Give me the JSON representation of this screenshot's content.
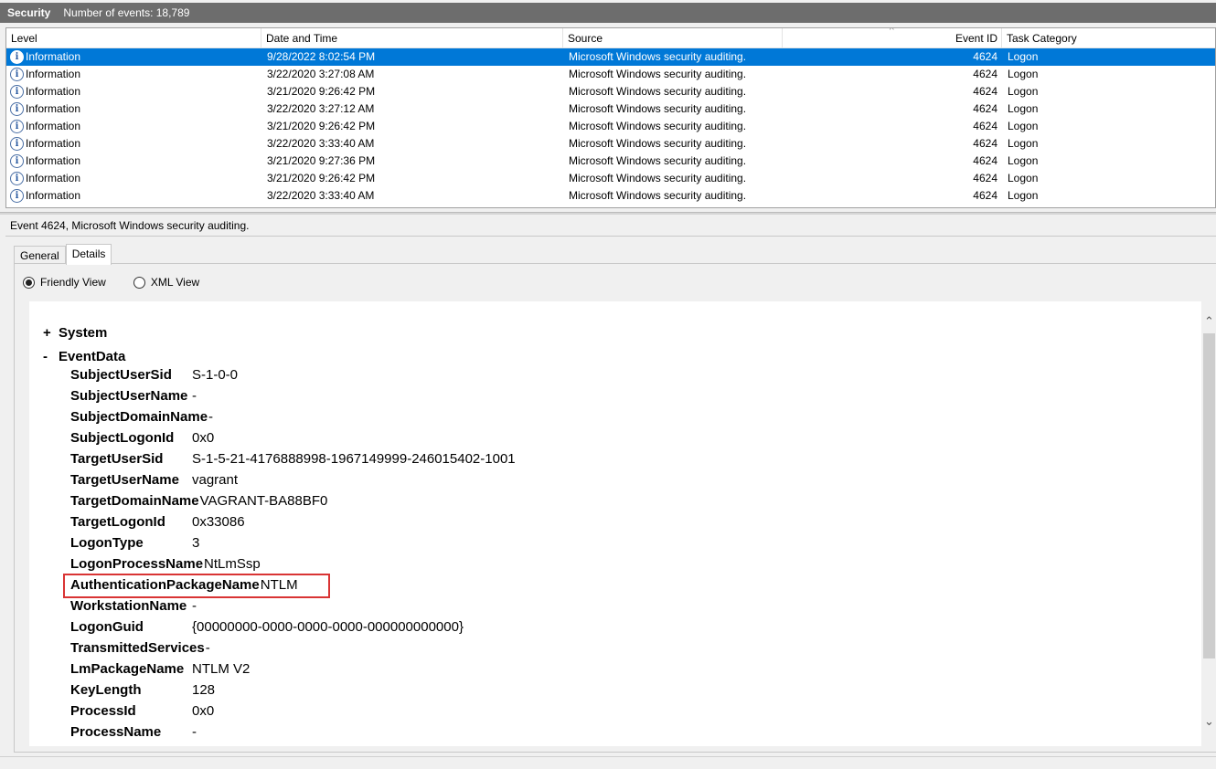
{
  "title": {
    "name": "Security",
    "events_label": "Number of events: 18,789"
  },
  "grid": {
    "columns": [
      "Level",
      "Date and Time",
      "Source",
      "Event ID",
      "Task Category"
    ],
    "sort_indicator": "^",
    "rows": [
      {
        "level": "Information",
        "date": "9/28/2022 8:02:54 PM",
        "source": "Microsoft Windows security auditing.",
        "id": "4624",
        "category": "Logon",
        "selected": true
      },
      {
        "level": "Information",
        "date": "3/22/2020 3:27:08 AM",
        "source": "Microsoft Windows security auditing.",
        "id": "4624",
        "category": "Logon"
      },
      {
        "level": "Information",
        "date": "3/21/2020 9:26:42 PM",
        "source": "Microsoft Windows security auditing.",
        "id": "4624",
        "category": "Logon"
      },
      {
        "level": "Information",
        "date": "3/22/2020 3:27:12 AM",
        "source": "Microsoft Windows security auditing.",
        "id": "4624",
        "category": "Logon"
      },
      {
        "level": "Information",
        "date": "3/21/2020 9:26:42 PM",
        "source": "Microsoft Windows security auditing.",
        "id": "4624",
        "category": "Logon"
      },
      {
        "level": "Information",
        "date": "3/22/2020 3:33:40 AM",
        "source": "Microsoft Windows security auditing.",
        "id": "4624",
        "category": "Logon"
      },
      {
        "level": "Information",
        "date": "3/21/2020 9:27:36 PM",
        "source": "Microsoft Windows security auditing.",
        "id": "4624",
        "category": "Logon"
      },
      {
        "level": "Information",
        "date": "3/21/2020 9:26:42 PM",
        "source": "Microsoft Windows security auditing.",
        "id": "4624",
        "category": "Logon"
      },
      {
        "level": "Information",
        "date": "3/22/2020 3:33:40 AM",
        "source": "Microsoft Windows security auditing.",
        "id": "4624",
        "category": "Logon"
      }
    ],
    "level_icon": "info-icon"
  },
  "event_header": "Event 4624, Microsoft Windows security auditing.",
  "tabs": [
    {
      "label": "General",
      "active": false
    },
    {
      "label": "Details",
      "active": true
    }
  ],
  "view_options": {
    "friendly": {
      "label": "Friendly View",
      "checked": true
    },
    "xml": {
      "label": "XML View",
      "checked": false
    }
  },
  "tree": {
    "system": {
      "sign": "+",
      "label": "System"
    },
    "eventdata": {
      "sign": "-",
      "label": "EventData"
    }
  },
  "fields": [
    {
      "name": "SubjectUserSid",
      "value": "S-1-0-0"
    },
    {
      "name": "SubjectUserName",
      "value": "-"
    },
    {
      "name": "SubjectDomainName",
      "value": "-"
    },
    {
      "name": "SubjectLogonId",
      "value": "0x0"
    },
    {
      "name": "TargetUserSid",
      "value": "S-1-5-21-4176888998-1967149999-246015402-1001"
    },
    {
      "name": "TargetUserName",
      "value": "vagrant"
    },
    {
      "name": "TargetDomainName",
      "value": "VAGRANT-BA88BF0"
    },
    {
      "name": "TargetLogonId",
      "value": "0x33086"
    },
    {
      "name": "LogonType",
      "value": "3"
    },
    {
      "name": "LogonProcessName",
      "value": "NtLmSsp"
    },
    {
      "name": "AuthenticationPackageName",
      "value": "NTLM",
      "highlighted": true
    },
    {
      "name": "WorkstationName",
      "value": "-"
    },
    {
      "name": "LogonGuid",
      "value": "{00000000-0000-0000-0000-000000000000}"
    },
    {
      "name": "TransmittedServices",
      "value": "-"
    },
    {
      "name": "LmPackageName",
      "value": "NTLM V2"
    },
    {
      "name": "KeyLength",
      "value": "128"
    },
    {
      "name": "ProcessId",
      "value": "0x0"
    },
    {
      "name": "ProcessName",
      "value": "-"
    }
  ],
  "colors": {
    "selection": "#0078d7",
    "highlight_box": "#d93434",
    "titlebar": "#6d6d6d"
  }
}
